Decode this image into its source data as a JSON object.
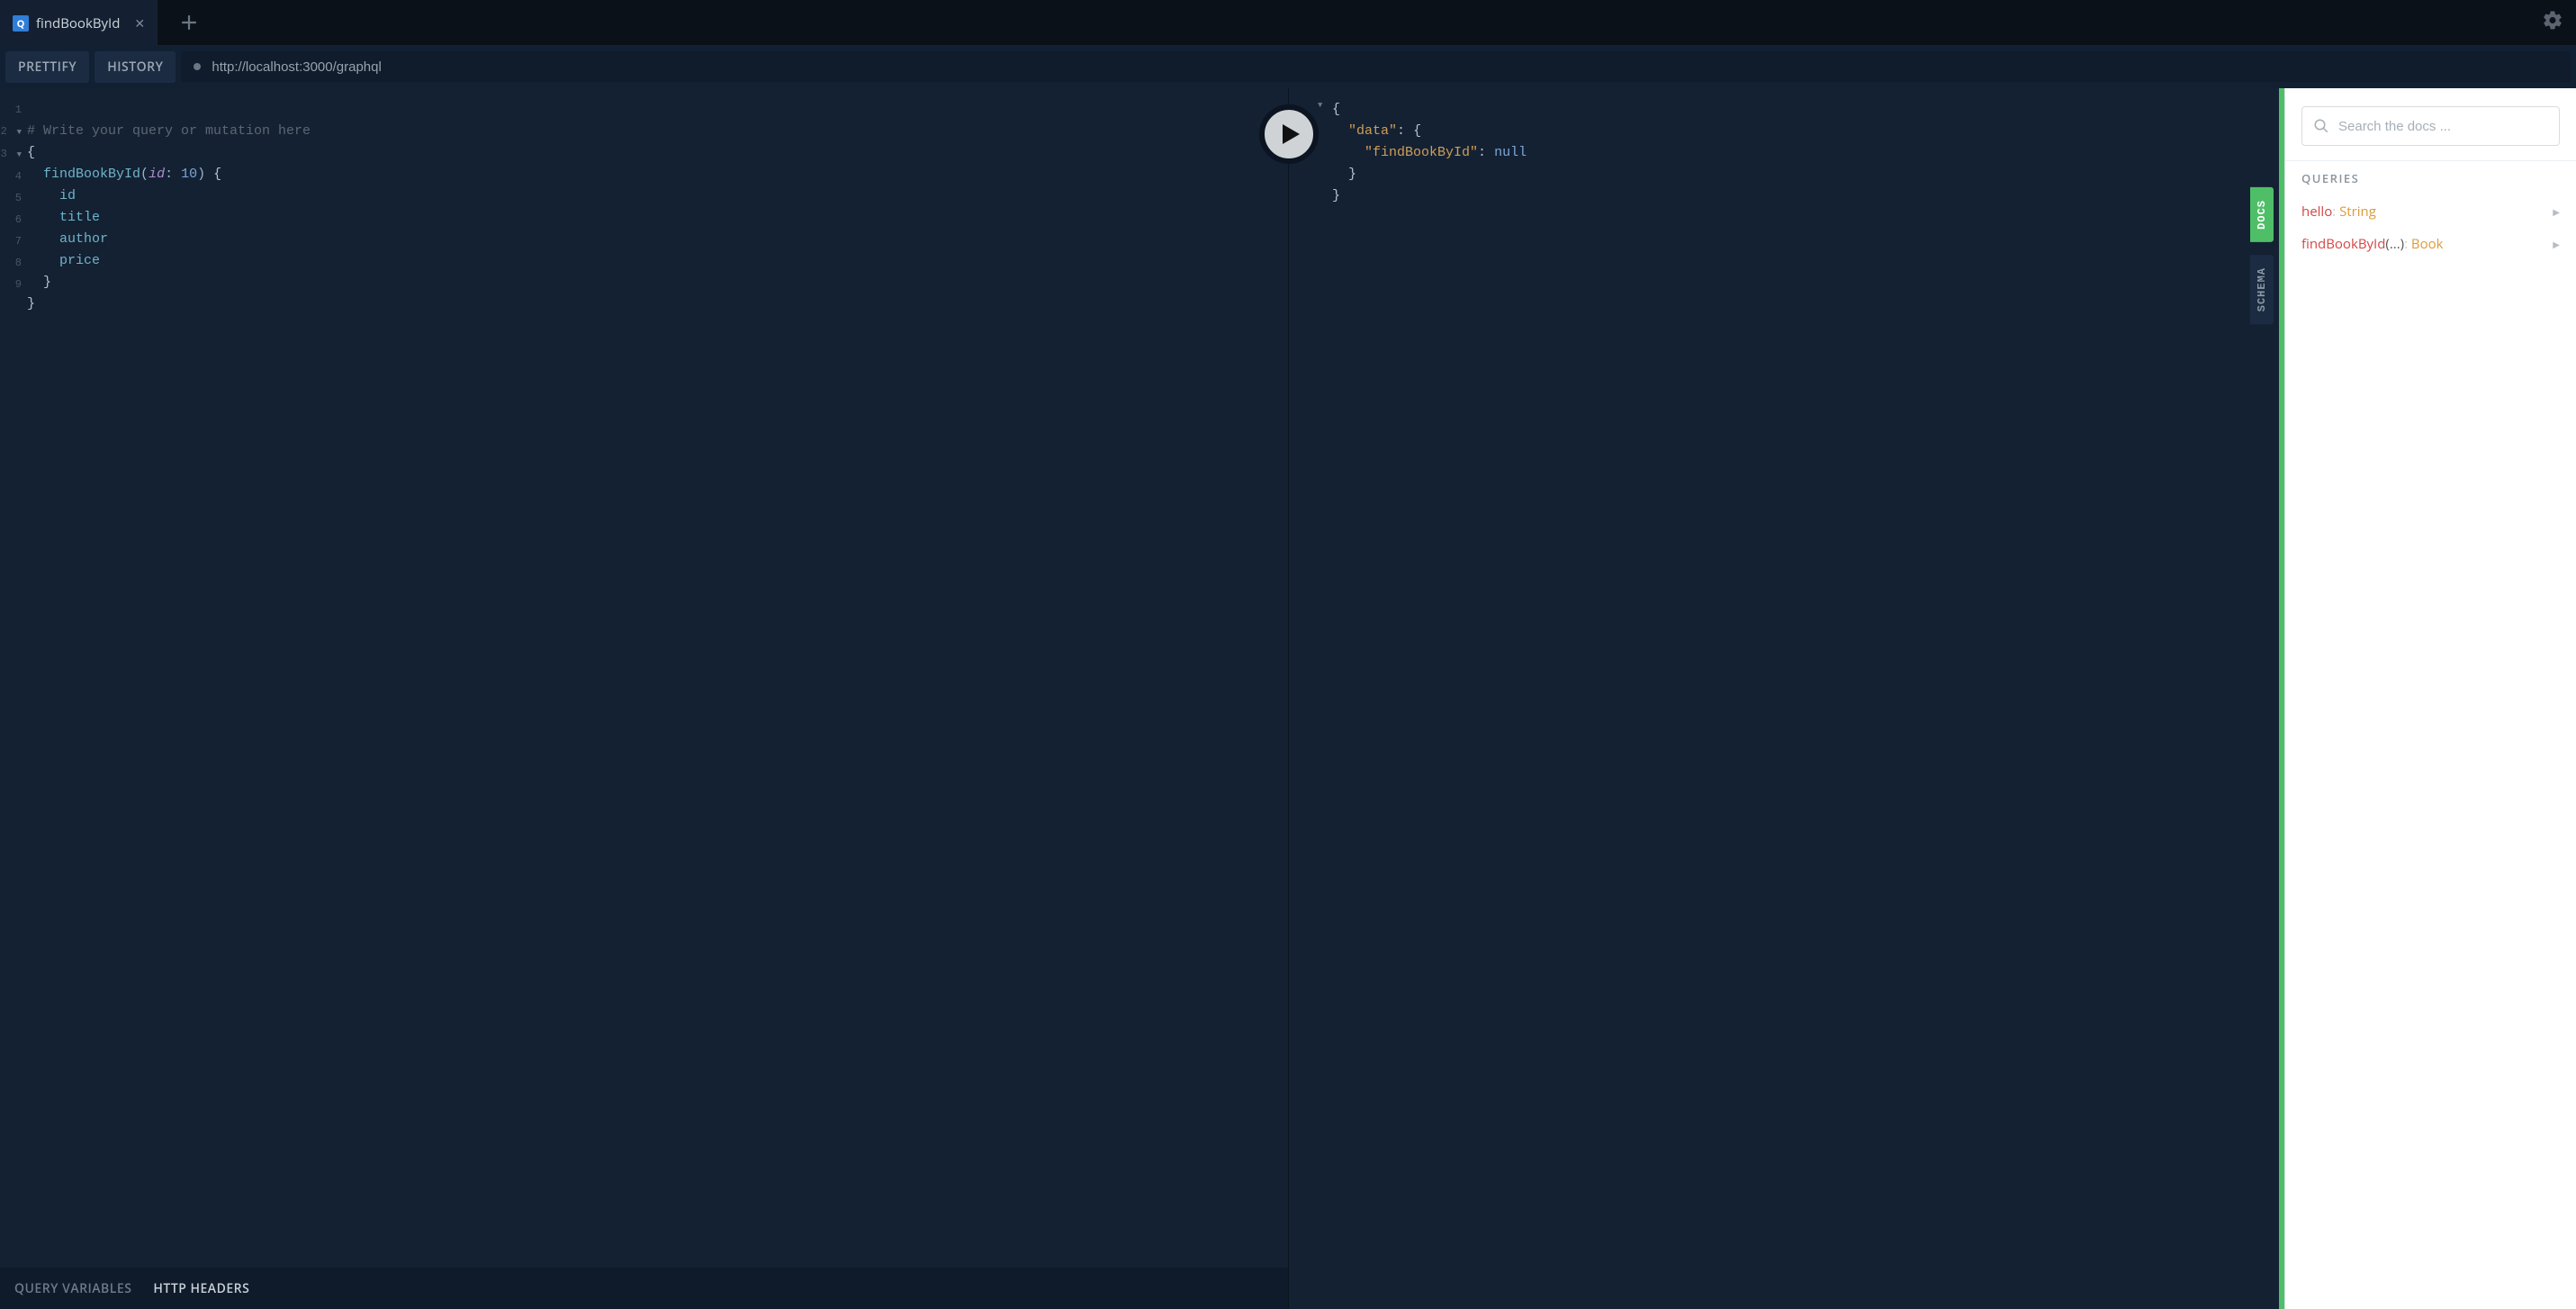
{
  "tabs": {
    "active": {
      "badge": "Q",
      "title": "findBookById"
    }
  },
  "toolbar": {
    "prettify": "Prettify",
    "history": "History",
    "endpoint": "http://localhost:3000/graphql"
  },
  "editor": {
    "lines": [
      "1",
      "2",
      "3",
      "4",
      "5",
      "6",
      "7",
      "8",
      "9"
    ],
    "comment": "# Write your query or mutation here",
    "query_name": "findBookById",
    "arg_name": "id",
    "arg_value": "10",
    "fields": [
      "id",
      "title",
      "author",
      "price"
    ]
  },
  "result": {
    "data_key": "\"data\"",
    "inner_key": "\"findBookById\"",
    "inner_value": "null"
  },
  "bottom": {
    "variables": "Query Variables",
    "headers": "HTTP Headers"
  },
  "side": {
    "docs": "DOCS",
    "schema": "SCHEMA"
  },
  "docs": {
    "search_placeholder": "Search the docs ...",
    "section": "QUERIES",
    "items": [
      {
        "name": "hello",
        "args": "",
        "sep": ": ",
        "type": "String"
      },
      {
        "name": "findBookById",
        "args": "(...)",
        "sep": ": ",
        "type": "Book"
      }
    ]
  }
}
